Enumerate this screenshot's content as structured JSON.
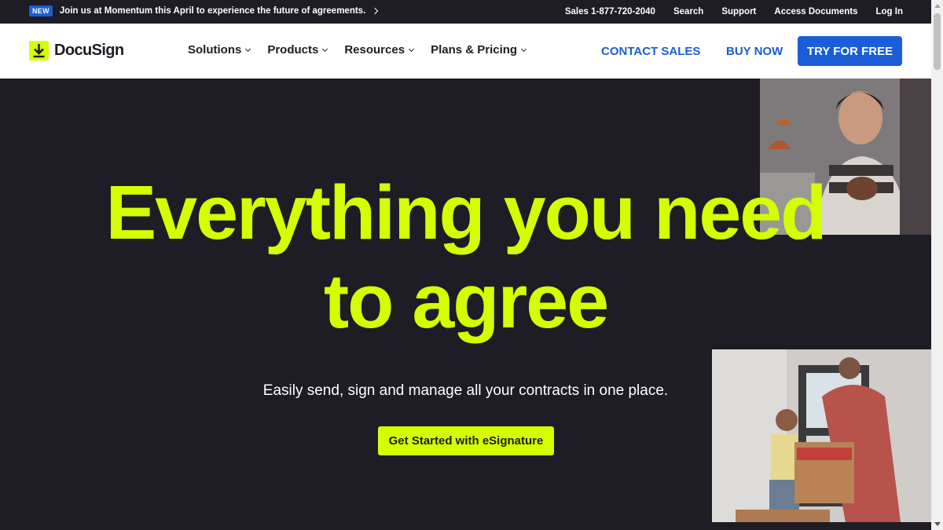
{
  "announcement": {
    "badge": "NEW",
    "text": "Join us at Momentum this April to experience the future of agreements."
  },
  "utility_nav": {
    "sales": "Sales 1-877-720-2040",
    "search": "Search",
    "support": "Support",
    "access_documents": "Access Documents",
    "login": "Log In"
  },
  "brand": {
    "name": "DocuSign",
    "accent_color": "#d4ff00",
    "primary_blue": "#1a5dd6",
    "background": "#1e1c24"
  },
  "main_nav": {
    "items": [
      {
        "label": "Solutions"
      },
      {
        "label": "Products"
      },
      {
        "label": "Resources"
      },
      {
        "label": "Plans & Pricing"
      }
    ],
    "contact_sales": "CONTACT SALES",
    "buy_now": "BUY NOW",
    "try_free": "TRY FOR FREE"
  },
  "hero": {
    "headline_line1": "Everything you need",
    "headline_line2": "to agree",
    "subheadline": "Easily send, sign and manage all your contracts in one place.",
    "cta": "Get Started with eSignature",
    "images": [
      {
        "subject": "woman-smiling-kitchen-photo"
      },
      {
        "subject": "father-and-child-moving-box-photo"
      }
    ]
  }
}
